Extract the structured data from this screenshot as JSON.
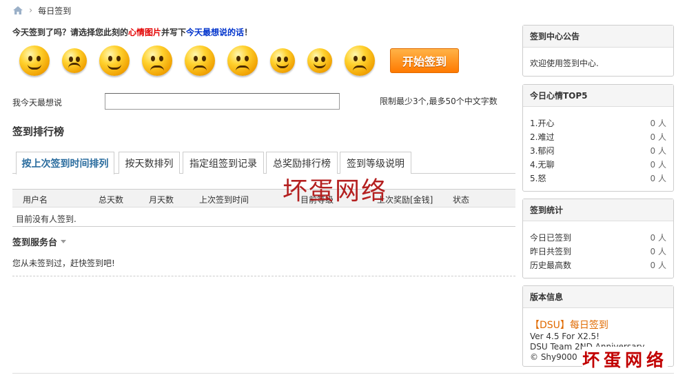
{
  "breadcrumb": {
    "home_icon": "home-icon",
    "current": "每日签到"
  },
  "checkin": {
    "prompt_a": "今天签到了吗？请选择您此刻的",
    "prompt_red": "心情图片",
    "prompt_b": "并写下",
    "prompt_blue": "今天最想说的话",
    "prompt_c": "！",
    "start_button": "开始签到",
    "say_label": "我今天最想说",
    "say_value": "",
    "say_hint": "限制最少3个,最多50个中文字数"
  },
  "ranking": {
    "title": "签到排行榜",
    "tabs": [
      "按上次签到时间排列",
      "按天数排列",
      "指定组签到记录",
      "总奖励排行榜",
      "签到等级说明"
    ],
    "columns": [
      "用户名",
      "总天数",
      "月天数",
      "上次签到时间",
      "目前等级",
      "上次奖励[金钱]",
      "状态"
    ],
    "empty": "目前没有人签到."
  },
  "service": {
    "title": "签到服务台",
    "text": "您从未签到过，赶快签到吧!"
  },
  "watermark": "坏蛋网络",
  "watermark2": "坏蛋网络",
  "sidebar": {
    "notice": {
      "title": "签到中心公告",
      "text": "欢迎使用签到中心."
    },
    "mood_top": {
      "title": "今日心情TOP5",
      "items": [
        {
          "label": "1.开心",
          "value": "0 人"
        },
        {
          "label": "2.难过",
          "value": "0 人"
        },
        {
          "label": "3.郁闷",
          "value": "0 人"
        },
        {
          "label": "4.无聊",
          "value": "0 人"
        },
        {
          "label": "5.怒",
          "value": "0 人"
        }
      ]
    },
    "stats": {
      "title": "签到统计",
      "items": [
        {
          "label": "今日已签到",
          "value": "0 人"
        },
        {
          "label": "昨日共签到",
          "value": "0 人"
        },
        {
          "label": "历史最高数",
          "value": "0 人"
        }
      ]
    },
    "version": {
      "title": "版本信息",
      "name": "【DSU】每日签到",
      "lines": [
        "Ver 4.5 For X2.5!",
        "DSU Team 2ND Anniversary",
        "© Shy9000"
      ]
    }
  }
}
